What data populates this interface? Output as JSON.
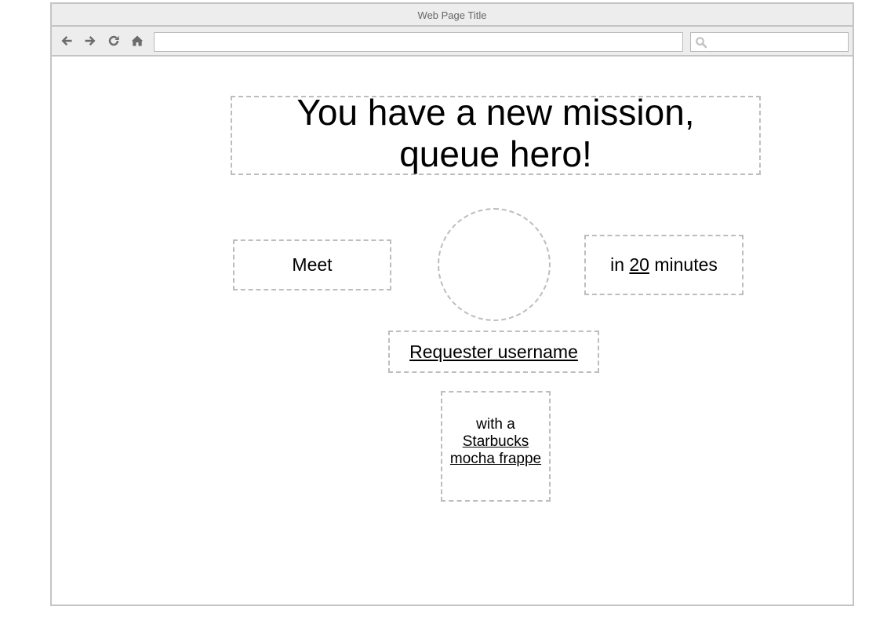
{
  "window": {
    "title": "Web Page Title"
  },
  "toolbar": {
    "icons": [
      "back-arrow-icon",
      "forward-arrow-icon",
      "reload-icon",
      "home-icon"
    ],
    "address_value": "",
    "search_value": "",
    "search_icon": "search-icon"
  },
  "main": {
    "heading_line1": "You have a new mission,",
    "heading_line2": "queue hero!",
    "meet_label": "Meet",
    "time_prefix": "in ",
    "time_value": "20",
    "time_suffix": " minutes",
    "requester_username": "Requester username",
    "drink_prefix": "with a",
    "drink_line1": "Starbucks",
    "drink_line2": "mocha frappe"
  },
  "colors": {
    "frame_border": "#c4c4c4",
    "chrome_background": "#ededed",
    "dashed_border": "#bdbdbd",
    "icon_color": "#6b6b6b",
    "text": "#000000"
  }
}
